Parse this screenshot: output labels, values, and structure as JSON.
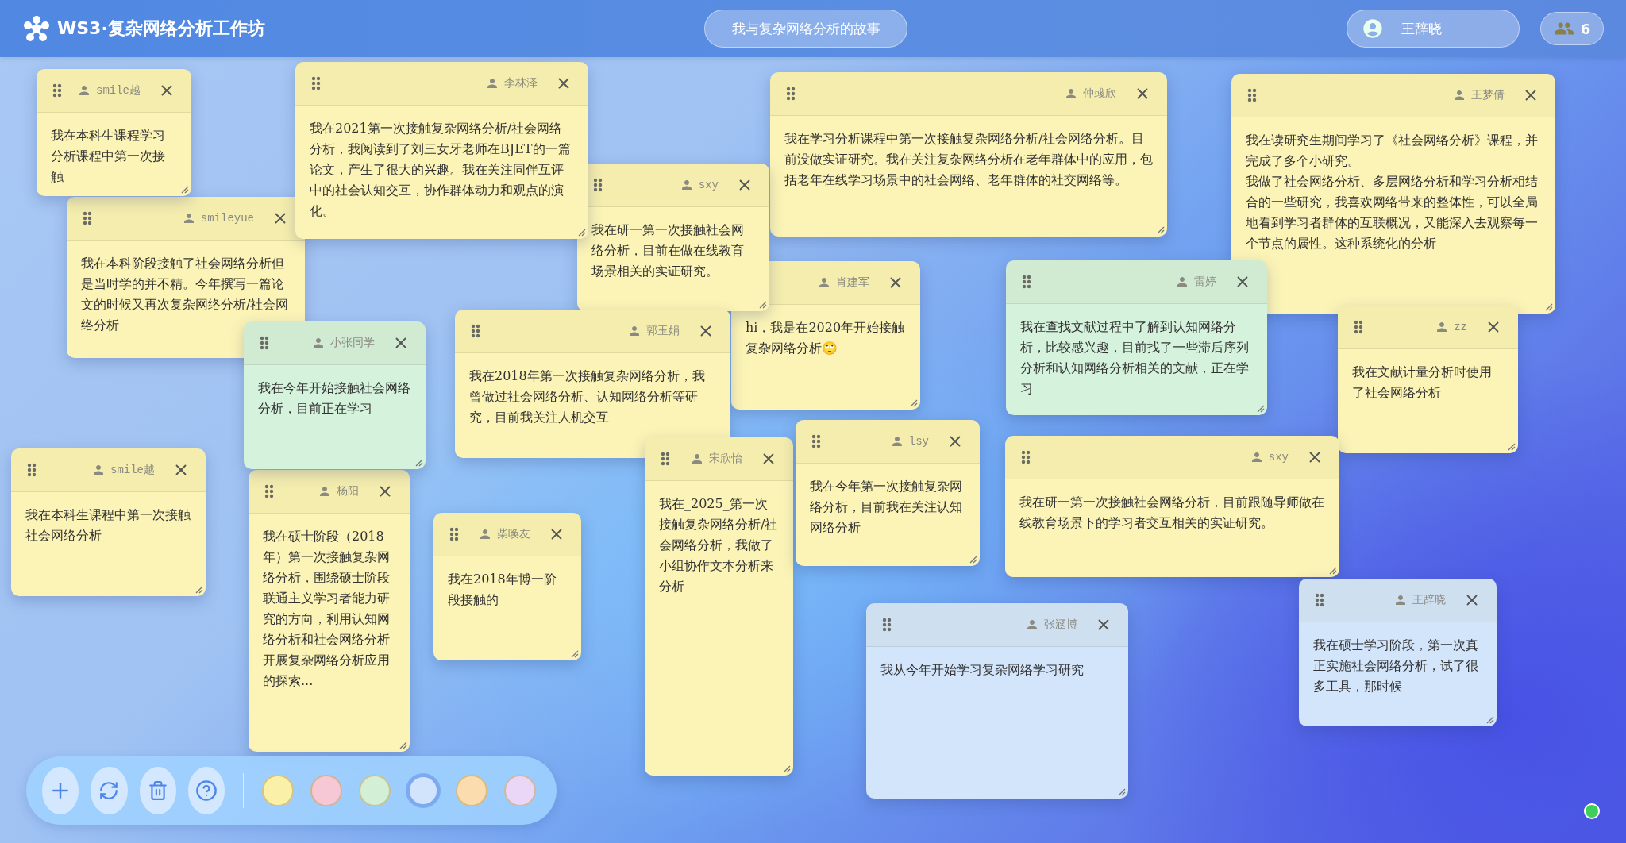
{
  "app": {
    "title": "WS3·复杂网络分析工作坊"
  },
  "header": {
    "topic": "我与复杂网络分析的故事",
    "user": "王辞晓",
    "online_count": "6"
  },
  "notes": [
    {
      "author": "smile越",
      "paragraphs": [
        "我在本科生课程学习分析课程中第一次接触"
      ],
      "color": "#fcf4b6"
    },
    {
      "author": "smileyue",
      "paragraphs": [
        "我在本科阶段接触了社会网络分析但是当时学的并不精。今年撰写一篇论文的时候又再次复杂网络分析/社会网络分析"
      ],
      "color": "#fcf4b6"
    },
    {
      "author": "李林泽",
      "paragraphs": [
        "我在2021第一次接触复杂网络分析/社会网络分析，我阅读到了刘三女牙老师在BJET的一篇论文，产生了很大的兴趣。我在关注同伴互评中的社会认知交互，协作群体动力和观点的演化。"
      ],
      "color": "#fcf4b6"
    },
    {
      "author": "sxy",
      "paragraphs": [
        "我在研一第一次接触社会网络分析，目前在做在线教育场景相关的实证研究。"
      ],
      "color": "#fcf4b6"
    },
    {
      "author": "仲彧欣",
      "paragraphs": [
        "我在学习分析课程中第一次接触复杂网络分析/社会网络分析。目前没做实证研究。我在关注复杂网络分析在老年群体中的应用，包括老年在线学习场景中的社会网络、老年群体的社交网络等。"
      ],
      "color": "#fcf4b6"
    },
    {
      "author": "王梦倩",
      "paragraphs": [
        "我在读研究生期间学习了《社会网络分析》课程，并完成了多个小研究。",
        "我做了社会网络分析、多层网络分析和学习分析相结合的一些研究，我喜欢网络带来的整体性，可以全局地看到学习者群体的互联概况，又能深入去观察每一个节点的属性。这种系统化的分析"
      ],
      "color": "#fcf4b6"
    },
    {
      "author": "肖建军",
      "paragraphs": [
        "hi，我是在2020年开始接触复杂网络分析🙄"
      ],
      "color": "#fcf4b6"
    },
    {
      "author": "雷婷",
      "paragraphs": [
        "我在查找文献过程中了解到认知网络分析，比较感兴趣，目前找了一些滞后序列分析和认知网络分析相关的文献，正在学习"
      ],
      "color": "#d5f2dc"
    },
    {
      "author": "zz",
      "paragraphs": [
        "我在文献计量分析时使用了社会网络分析"
      ],
      "color": "#fcf4b6"
    },
    {
      "author": "小张同学",
      "paragraphs": [
        "我在今年开始接触社会网络分析，目前正在学习"
      ],
      "color": "#d5f2dc"
    },
    {
      "author": "郭玉娟",
      "paragraphs": [
        "我在2018年第一次接触复杂网络分析，我曾做过社会网络分析、认知网络分析等研究，目前我关注人机交互"
      ],
      "color": "#fcf4b6"
    },
    {
      "author": "smile越",
      "paragraphs": [
        "我在本科生课程中第一次接触社会网络分析"
      ],
      "color": "#fcf4b6"
    },
    {
      "author": "杨阳",
      "paragraphs": [
        "我在硕士阶段（2018年）第一次接触复杂网络分析，围绕硕士阶段联通主义学习者能力研究的方向，利用认知网络分析和社会网络分析开展复杂网络分析应用的探索..."
      ],
      "color": "#fcf4b6"
    },
    {
      "author": "柴唤友",
      "paragraphs": [
        "我在2018年博一阶段接触的"
      ],
      "color": "#fcf4b6"
    },
    {
      "author": "宋欣怡",
      "paragraphs": [
        "我在_2025_第一次接触复杂网络分析/社会网络分析，我做了小组协作文本分析来分析"
      ],
      "color": "#fcf4b6"
    },
    {
      "author": "lsy",
      "paragraphs": [
        "我在今年第一次接触复杂网络分析，目前我在关注认知网络分析"
      ],
      "color": "#fcf4b6"
    },
    {
      "author": "sxy",
      "paragraphs": [
        "我在研一第一次接触社会网络分析，目前跟随导师做在线教育场景下的学习者交互相关的实证研究。"
      ],
      "color": "#fcf4b6"
    },
    {
      "author": "张涵博",
      "paragraphs": [
        "我从今年开始学习复杂网络学习研究"
      ],
      "color": "#d3e5fb"
    },
    {
      "author": "王辞晓",
      "paragraphs": [
        "我在硕士学习阶段，第一次真正实施社会网络分析，试了很多工具，那时候"
      ],
      "color": "#d3e5fb"
    }
  ],
  "toolbar": {
    "swatches": [
      {
        "color": "#fbf0a8",
        "selected": false
      },
      {
        "color": "#f6c8d6",
        "selected": false
      },
      {
        "color": "#d3efd6",
        "selected": false
      },
      {
        "color": "#d2e4fb",
        "selected": true
      },
      {
        "color": "#fbdcae",
        "selected": false
      },
      {
        "color": "#ead6f6",
        "selected": false
      }
    ]
  }
}
